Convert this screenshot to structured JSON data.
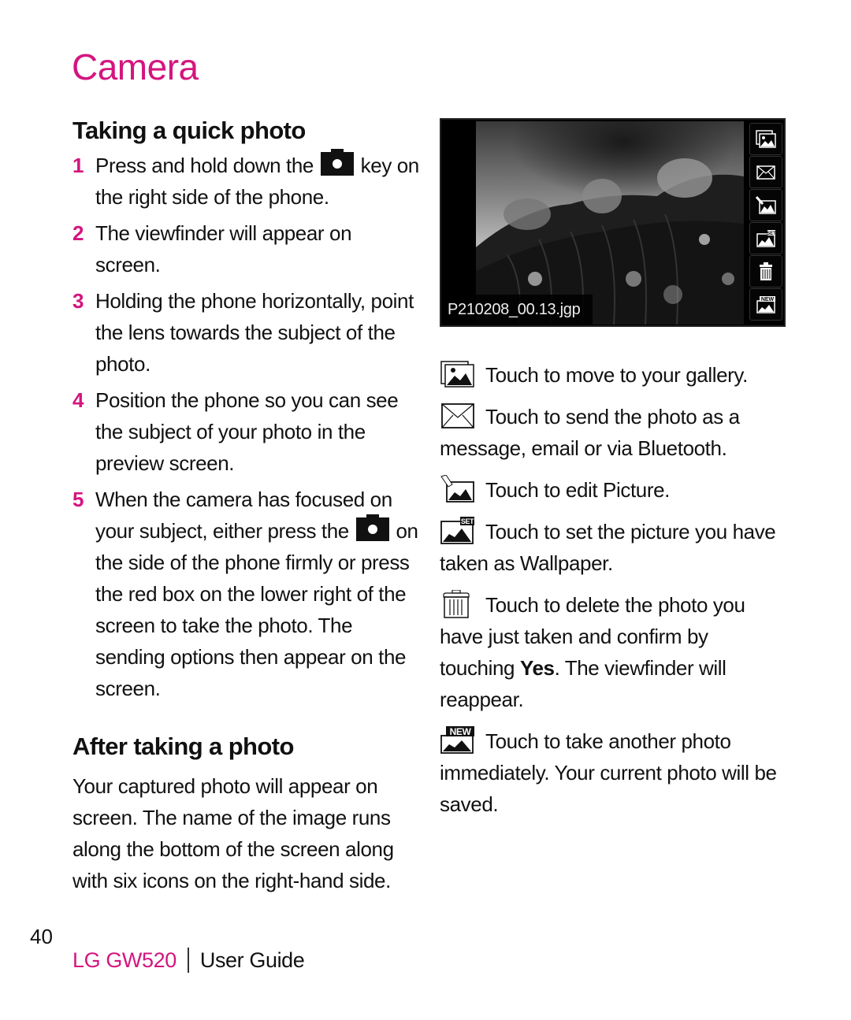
{
  "page": {
    "title": "Camera",
    "accent_color": "#d4157f",
    "page_number": "40"
  },
  "quick_photo": {
    "heading": "Taking a quick photo",
    "steps": [
      {
        "num": "1",
        "text_before": "Press and hold down the",
        "icon": "camera-key-icon",
        "text_after": "key on the right side of the phone."
      },
      {
        "num": "2",
        "text": "The viewfinder will appear on screen."
      },
      {
        "num": "3",
        "text": "Holding the phone horizontally, point the lens towards the subject of the photo."
      },
      {
        "num": "4",
        "text": "Position the phone so you can see the subject of your photo in the preview screen."
      },
      {
        "num": "5",
        "text_before": "When the camera has focused on your subject, either press the",
        "icon": "camera-key-icon",
        "text_after": "on the side of the phone firmly or press the red box on the lower right of the screen to take the photo. The sending options then appear on the screen."
      }
    ]
  },
  "after_photo": {
    "heading": "After taking a photo",
    "body": "Your captured photo will appear on screen. The name of the image runs along the bottom of the screen along with six icons on the right-hand side."
  },
  "screen": {
    "filename": "P210208_00.13.jgp",
    "side_buttons": [
      {
        "name": "gallery",
        "icon": "gallery-icon"
      },
      {
        "name": "send",
        "icon": "envelope-icon"
      },
      {
        "name": "edit",
        "icon": "edit-picture-icon"
      },
      {
        "name": "set-wallpaper",
        "icon": "set-wallpaper-icon"
      },
      {
        "name": "delete",
        "icon": "trash-icon"
      },
      {
        "name": "new-photo",
        "icon": "new-photo-icon"
      }
    ]
  },
  "icon_descriptions": [
    {
      "icon": "gallery-icon",
      "text": "Touch to move to your gallery."
    },
    {
      "icon": "envelope-icon",
      "text": "Touch to send the photo as a message, email or via Bluetooth."
    },
    {
      "icon": "edit-picture-icon",
      "text": "Touch to edit Picture."
    },
    {
      "icon": "set-wallpaper-icon",
      "text": "Touch to set the picture you have taken as Wallpaper."
    },
    {
      "icon": "trash-icon",
      "text_before": "Touch to delete the photo you have just taken and confirm by touching ",
      "bold": "Yes",
      "text_after": ". The viewfinder will reappear."
    },
    {
      "icon": "new-photo-icon",
      "text": "Touch to take another photo immediately. Your current photo will be saved."
    }
  ],
  "footer": {
    "brand": "LG GW520",
    "guide": "User Guide"
  }
}
